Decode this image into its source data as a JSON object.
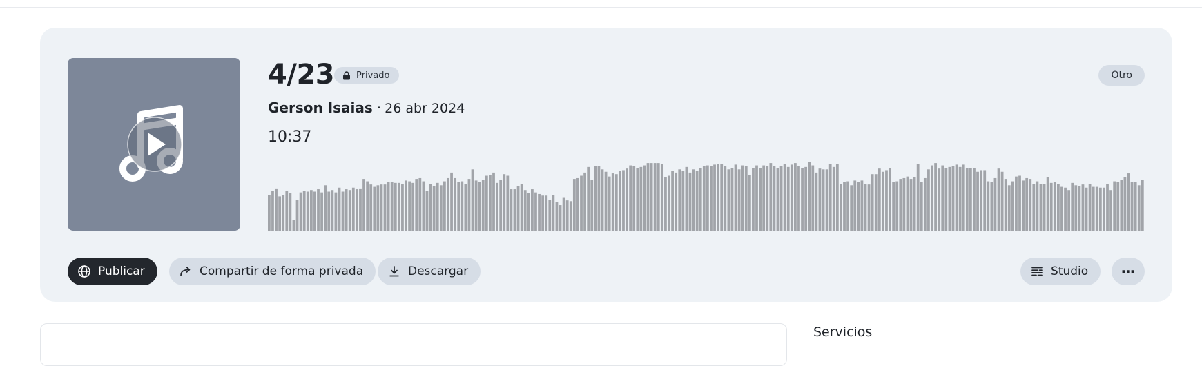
{
  "track": {
    "title": "4/23",
    "visibility": "Privado",
    "category": "Otro",
    "author": "Gerson Isaias",
    "separator": "·",
    "date": "26 abr 2024",
    "duration": "10:37",
    "waveform_levels": [
      0.46,
      0.51,
      0.54,
      0.44,
      0.46,
      0.51,
      0.48,
      0.14,
      0.4,
      0.49,
      0.51,
      0.5,
      0.52,
      0.5,
      0.53,
      0.49,
      0.58,
      0.5,
      0.52,
      0.49,
      0.55,
      0.5,
      0.53,
      0.52,
      0.55,
      0.53,
      0.54,
      0.66,
      0.63,
      0.59,
      0.56,
      0.58,
      0.59,
      0.59,
      0.62,
      0.62,
      0.61,
      0.61,
      0.6,
      0.64,
      0.63,
      0.61,
      0.66,
      0.67,
      0.63,
      0.51,
      0.6,
      0.57,
      0.61,
      0.58,
      0.63,
      0.67,
      0.74,
      0.67,
      0.62,
      0.63,
      0.6,
      0.66,
      0.78,
      0.64,
      0.62,
      0.65,
      0.7,
      0.71,
      0.74,
      0.61,
      0.65,
      0.72,
      0.7,
      0.53,
      0.53,
      0.57,
      0.6,
      0.52,
      0.48,
      0.53,
      0.49,
      0.47,
      0.45,
      0.45,
      0.4,
      0.46,
      0.37,
      0.33,
      0.43,
      0.39,
      0.38,
      0.66,
      0.67,
      0.7,
      0.74,
      0.81,
      0.65,
      0.82,
      0.82,
      0.78,
      0.75,
      0.69,
      0.73,
      0.72,
      0.76,
      0.77,
      0.79,
      0.83,
      0.82,
      0.8,
      0.81,
      0.83,
      0.86,
      0.86,
      0.86,
      0.86,
      0.85,
      0.68,
      0.7,
      0.76,
      0.74,
      0.78,
      0.76,
      0.81,
      0.74,
      0.78,
      0.76,
      0.8,
      0.82,
      0.83,
      0.82,
      0.84,
      0.85,
      0.85,
      0.82,
      0.78,
      0.8,
      0.84,
      0.78,
      0.83,
      0.82,
      0.71,
      0.8,
      0.83,
      0.8,
      0.83,
      0.82,
      0.86,
      0.82,
      0.8,
      0.82,
      0.85,
      0.81,
      0.84,
      0.86,
      0.82,
      0.8,
      0.81,
      0.87,
      0.83,
      0.74,
      0.79,
      0.78,
      0.78,
      0.85,
      0.81,
      0.85,
      0.6,
      0.62,
      0.63,
      0.58,
      0.64,
      0.62,
      0.64,
      0.6,
      0.59,
      0.72,
      0.72,
      0.79,
      0.75,
      0.77,
      0.8,
      0.62,
      0.63,
      0.66,
      0.67,
      0.69,
      0.66,
      0.68,
      0.85,
      0.62,
      0.67,
      0.78,
      0.83,
      0.86,
      0.79,
      0.83,
      0.8,
      0.81,
      0.82,
      0.84,
      0.81,
      0.84,
      0.8,
      0.8,
      0.8,
      0.75,
      0.77,
      0.77,
      0.63,
      0.62,
      0.67,
      0.79,
      0.75,
      0.66,
      0.58,
      0.63,
      0.69,
      0.7,
      0.64,
      0.67,
      0.66,
      0.6,
      0.63,
      0.6,
      0.6,
      0.68,
      0.61,
      0.62,
      0.6,
      0.56,
      0.55,
      0.52,
      0.61,
      0.58,
      0.57,
      0.59,
      0.55,
      0.6,
      0.56,
      0.56,
      0.55,
      0.55,
      0.6,
      0.52,
      0.63,
      0.62,
      0.65,
      0.68,
      0.73,
      0.62,
      0.62,
      0.58,
      0.65
    ],
    "waveform_color": "#a1a4a9"
  },
  "actions": {
    "publish": "Publicar",
    "share": "Compartir de forma privada",
    "download": "Descargar",
    "studio": "Studio",
    "more": "⋯"
  },
  "sections": {
    "services": "Servicios"
  },
  "colors": {
    "card_bg": "#eef2f6",
    "cover_bg": "#7d8799",
    "pill_bg": "#d6dde6",
    "primary_btn": "#23272d"
  }
}
